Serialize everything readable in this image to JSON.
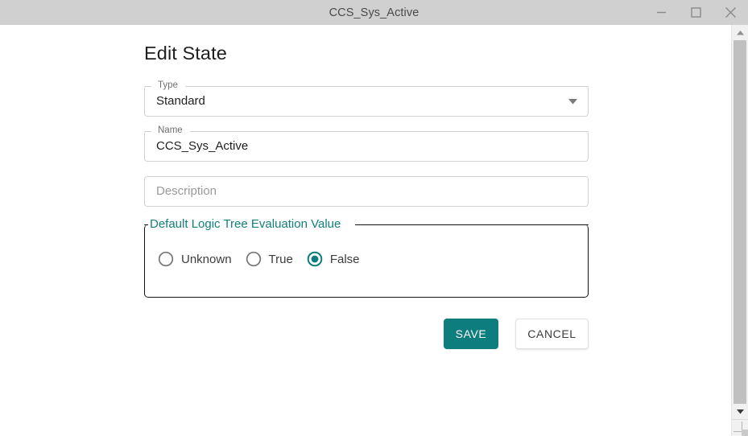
{
  "window": {
    "title": "CCS_Sys_Active",
    "controls": [
      {
        "name": "minimize",
        "label": "Minimize"
      },
      {
        "name": "maximize",
        "label": "Maximize"
      },
      {
        "name": "close",
        "label": "Close"
      }
    ]
  },
  "colors": {
    "accent_teal": "#0d7d7d",
    "legend_teal": "#117f7c",
    "titlebar": "#d0d0d0",
    "field_border": "#d3d3d3",
    "fieldset_border": "#111111",
    "scrollbar_thumb": "#c0c0c0"
  },
  "form": {
    "heading": "Edit State",
    "type_field": {
      "label": "Type",
      "value": "Standard",
      "caret_icon": "chevron-down-icon"
    },
    "name_field": {
      "label": "Name",
      "value": "CCS_Sys_Active"
    },
    "description_field": {
      "placeholder": "Description",
      "value": ""
    },
    "logic_tree_group": {
      "legend": "Default Logic Tree Evaluation Value",
      "selected": "False",
      "options": [
        {
          "label": "Unknown",
          "selected": false
        },
        {
          "label": "True",
          "selected": false
        },
        {
          "label": "False",
          "selected": true
        }
      ]
    },
    "actions": {
      "save_label": "SAVE",
      "cancel_label": "CANCEL"
    }
  },
  "scrollbar": {
    "up_icon": "triangle-up-icon",
    "down_icon": "triangle-down-icon"
  }
}
